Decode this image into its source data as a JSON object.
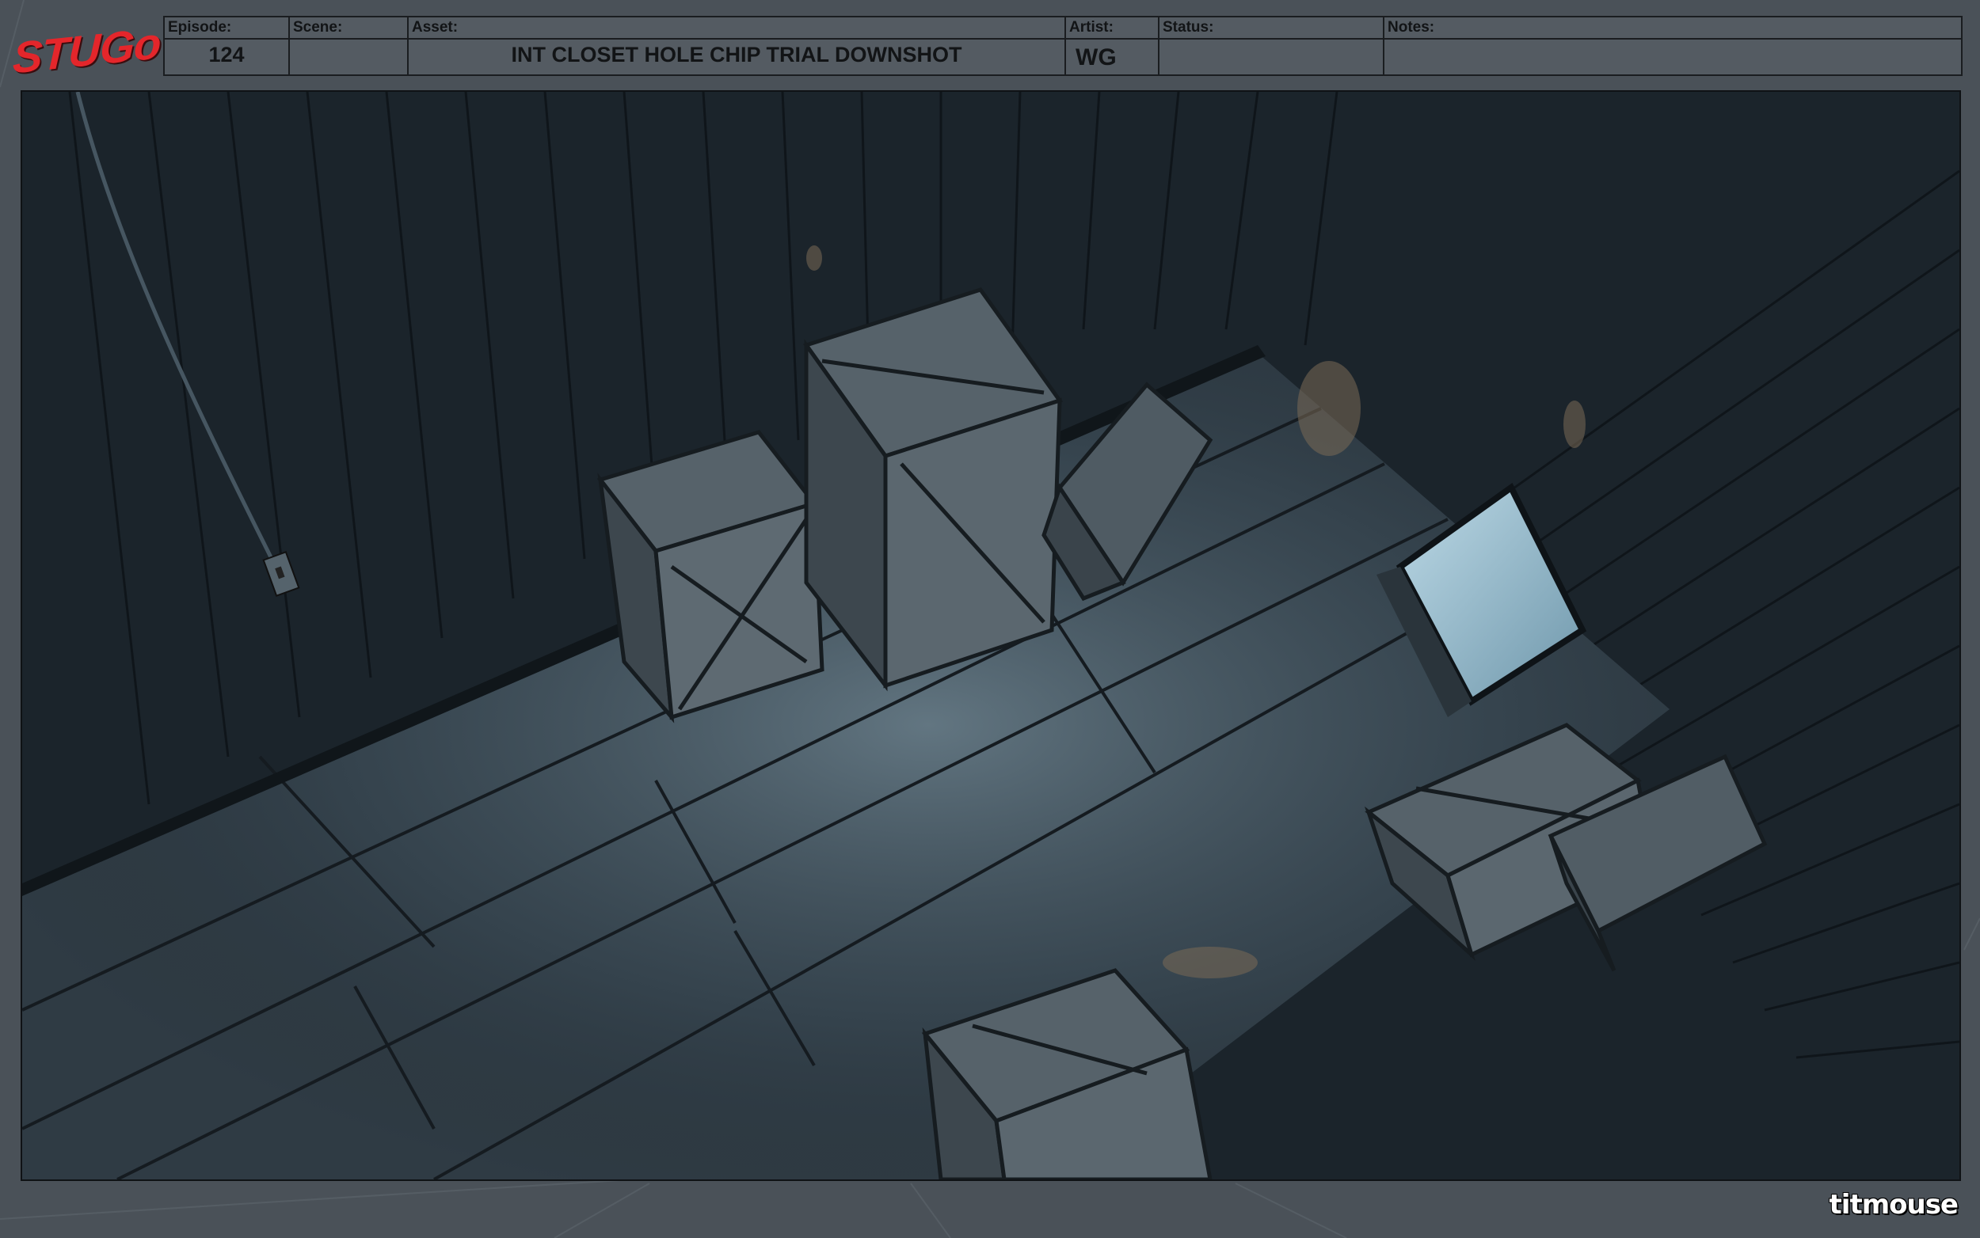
{
  "brand": {
    "logo_text": "STUGo",
    "studio_text": "titmouse"
  },
  "header": {
    "episode_label": "Episode:",
    "episode_value": "124",
    "scene_label": "Scene:",
    "scene_value": "",
    "asset_label": "Asset:",
    "asset_value": "INT CLOSET HOLE CHIP TRIAL DOWNSHOT",
    "artist_label": "Artist:",
    "artist_value": "WG",
    "status_label": "Status:",
    "status_value": "",
    "notes_label": "Notes:",
    "notes_value": ""
  },
  "icons": {
    "logo": "stugo-logo-icon",
    "studio": "titmouse-logo-icon",
    "outlet": "wall-outlet-icon"
  },
  "colors": {
    "sheet_bg": "#4a5158",
    "frame_bg": "#1c252c",
    "logo_red": "#e4262b",
    "window_glow": "#8fb6c8"
  }
}
